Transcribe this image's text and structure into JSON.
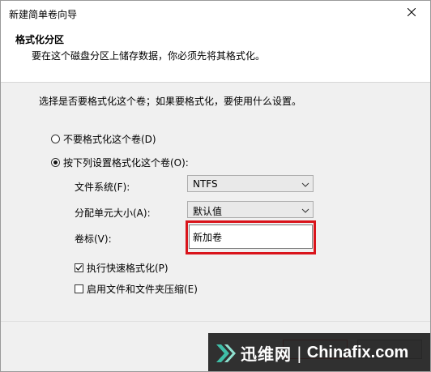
{
  "window": {
    "title": "新建简单卷向导"
  },
  "header": {
    "title": "格式化分区",
    "subtitle": "要在这个磁盘分区上储存数据，你必须先将其格式化。"
  },
  "main": {
    "intro": "选择是否要格式化这个卷；如果要格式化，要使用什么设置。",
    "radio_no_format": {
      "label": "不要格式化这个卷(D)",
      "checked": false
    },
    "radio_format": {
      "label": "按下列设置格式化这个卷(O):",
      "checked": true
    },
    "file_system": {
      "label": "文件系统(F):",
      "value": "NTFS"
    },
    "allocation_size": {
      "label": "分配单元大小(A):",
      "value": "默认值"
    },
    "volume_label": {
      "label": "卷标(V):",
      "value": "新加卷"
    },
    "quick_format": {
      "label": "执行快速格式化(P)",
      "checked": true
    },
    "compression": {
      "label": "启用文件和文件夹压缩(E)",
      "checked": false
    }
  },
  "watermark": {
    "brand_cn": "迅维网",
    "separator": "|",
    "brand_en": "Chinafix.com"
  },
  "colors": {
    "highlight_frame": "#d9141b",
    "content_bg": "#f0f0f0",
    "watermark_bg": "#141414",
    "logo_accent": "#3fbfa8"
  }
}
